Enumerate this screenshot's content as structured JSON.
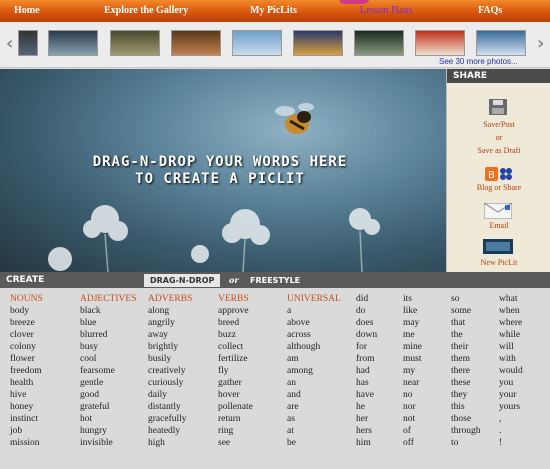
{
  "nav": {
    "home": "Home",
    "explore": "Explore the Gallery",
    "mypiclits": "My PicLits",
    "lesson_plans": "Lesson Plans",
    "faqs": "FAQs"
  },
  "strip": {
    "prev_arrow": "‹",
    "next_arrow": "›",
    "see_more": "See 30 more photos..."
  },
  "hero": {
    "line1": "DRAG-N-DROP YOUR WORDS HERE",
    "line2": "TO CREATE A PICLIT"
  },
  "share": {
    "heading": "SHARE",
    "save_post": "Save/Post",
    "or": "or",
    "save_draft": "Save as Draft",
    "blog_share": "Blog or Share",
    "email": "Email",
    "new_piclit": "New PicLit"
  },
  "create": {
    "label": "CREATE",
    "tab_dragndrop": "DRAG-N-DROP",
    "or": "or",
    "tab_freestyle": "FREESTYLE"
  },
  "word_columns": [
    {
      "header": "NOUNS",
      "words": [
        "body",
        "breeze",
        "clover",
        "colony",
        "flower",
        "freedom",
        "health",
        "hive",
        "honey",
        "instinct",
        "job",
        "mission"
      ]
    },
    {
      "header": "ADJECTIVES",
      "words": [
        "black",
        "blue",
        "blurred",
        "busy",
        "cool",
        "fearsome",
        "gentle",
        "good",
        "grateful",
        "hot",
        "hungry",
        "invisible"
      ]
    },
    {
      "header": "ADVERBS",
      "words": [
        "along",
        "angrily",
        "away",
        "brightly",
        "busily",
        "creatively",
        "curiously",
        "daily",
        "distantly",
        "gracefully",
        "heatedly",
        "high"
      ]
    },
    {
      "header": "VERBS",
      "words": [
        "approve",
        "breed",
        "buzz",
        "collect",
        "fertilize",
        "fly",
        "gather",
        "hover",
        "pollenate",
        "return",
        "ring",
        "see"
      ]
    },
    {
      "header": "UNIVERSAL",
      "words": [
        "a",
        "above",
        "across",
        "although",
        "am",
        "among",
        "an",
        "and",
        "are",
        "as",
        "at",
        "be"
      ]
    },
    {
      "header": "",
      "words": [
        "did",
        "do",
        "does",
        "down",
        "for",
        "from",
        "had",
        "has",
        "have",
        "he",
        "her",
        "hers",
        "him"
      ]
    },
    {
      "header": "",
      "words": [
        "its",
        "like",
        "may",
        "me",
        "mine",
        "must",
        "my",
        "near",
        "no",
        "nor",
        "not",
        "of",
        "off"
      ]
    },
    {
      "header": "",
      "words": [
        "so",
        "some",
        "that",
        "the",
        "their",
        "them",
        "there",
        "these",
        "they",
        "this",
        "those",
        "through",
        "to"
      ]
    },
    {
      "header": "",
      "words": [
        "what",
        "when",
        "where",
        "while",
        "will",
        "with",
        "would",
        "you",
        "your",
        "yours",
        ",",
        ".",
        "!"
      ]
    }
  ],
  "colors": {
    "nav_orange": "#d5520c",
    "accent_link": "#b43c10",
    "word_header": "#c0501a",
    "panel_dark": "#4a4a4a"
  }
}
